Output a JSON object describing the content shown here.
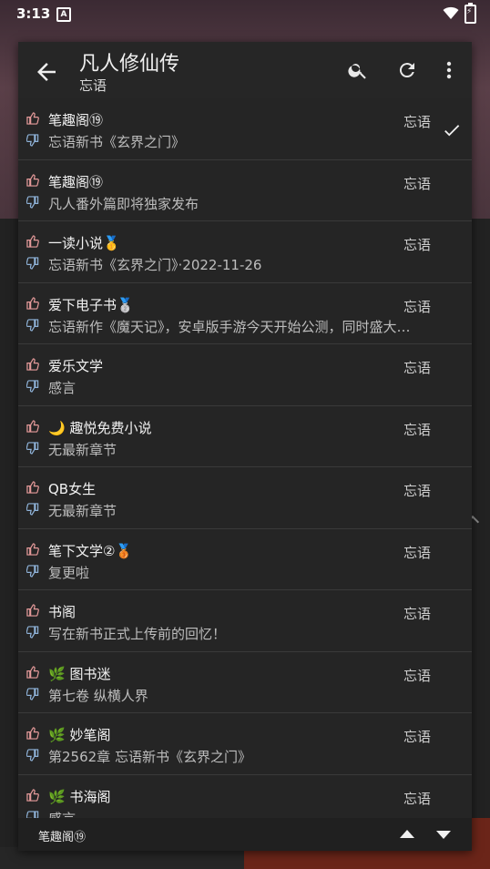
{
  "status_bar": {
    "time": "3:13",
    "notif_letter": "A"
  },
  "header": {
    "title": "凡人修仙传",
    "subtitle": "忘语"
  },
  "icons": {
    "back": "arrow-left-icon",
    "search": "search-icon",
    "refresh": "refresh-icon",
    "more": "more-vert-icon",
    "up": "thumb-up-icon",
    "down": "thumb-down-icon",
    "check": "check-icon"
  },
  "colors": {
    "up_icon": "#e59a9a",
    "down_icon": "#8fb3d9",
    "accent": "#6b2519"
  },
  "sources": [
    {
      "name": "笔趣阁⑲",
      "desc": "忘语新书《玄界之门》",
      "author": "忘语",
      "selected": true
    },
    {
      "name": "笔趣阁⑲",
      "desc": "凡人番外篇即将独家发布",
      "author": "忘语",
      "selected": false
    },
    {
      "name": "一读小说🥇",
      "desc": "忘语新书《玄界之门》·2022-11-26",
      "author": "忘语",
      "selected": false
    },
    {
      "name": "爱下电子书🥈",
      "desc": "忘语新作《魔天记》，安卓版手游今天开始公测，同时盛大…",
      "author": "忘语",
      "selected": false
    },
    {
      "name": "爱乐文学",
      "desc": "感言",
      "author": "忘语",
      "selected": false
    },
    {
      "name": "🌙 趣悦免费小说",
      "desc": "无最新章节",
      "author": "忘语",
      "selected": false
    },
    {
      "name": "QB女生",
      "desc": "无最新章节",
      "author": "忘语",
      "selected": false
    },
    {
      "name": "笔下文学②🥉",
      "desc": "复更啦",
      "author": "忘语",
      "selected": false
    },
    {
      "name": "书阁",
      "desc": "写在新书正式上传前的回忆！",
      "author": "忘语",
      "selected": false
    },
    {
      "name": "🌿 图书迷",
      "desc": "第七卷 纵横人界",
      "author": "忘语",
      "selected": false
    },
    {
      "name": "🌿 妙笔阁",
      "desc": "第2562章 忘语新书《玄界之门》",
      "author": "忘语",
      "selected": false
    },
    {
      "name": "🌿 书海阁",
      "desc": "感言",
      "author": "忘语",
      "selected": false
    }
  ],
  "bottom_bar": {
    "current_source": "笔趣阁⑲"
  }
}
